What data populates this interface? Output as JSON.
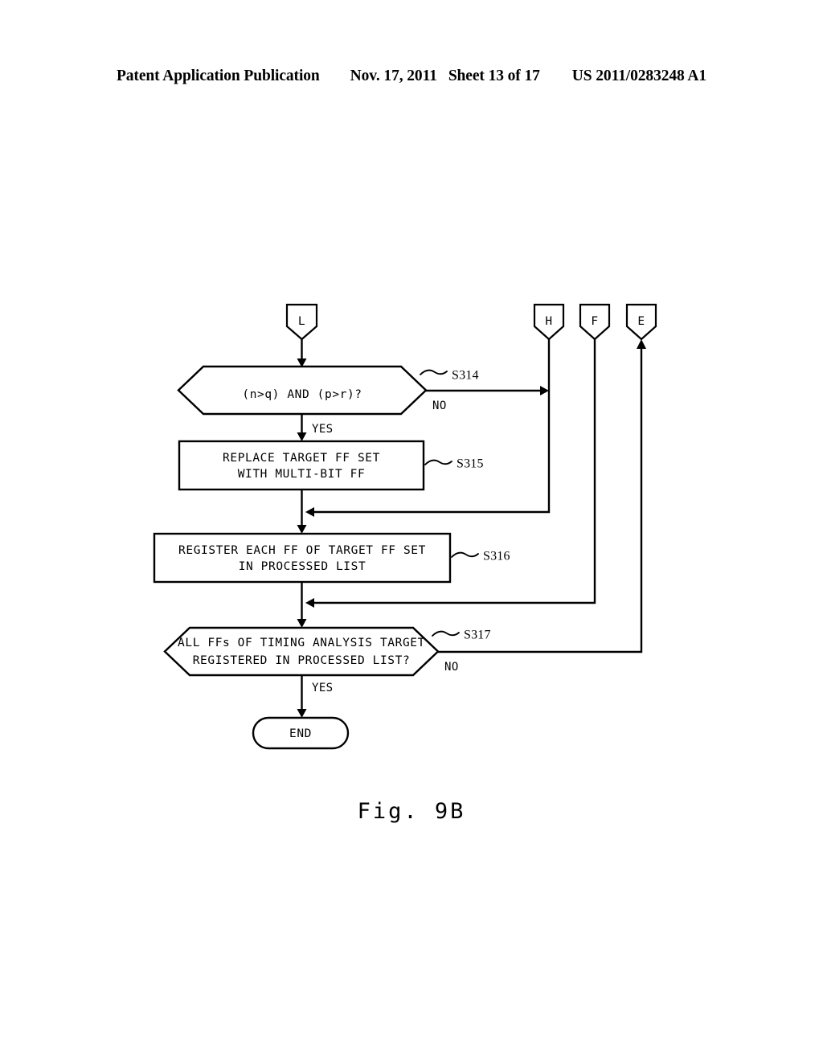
{
  "header": {
    "publication": "Patent Application Publication",
    "date": "Nov. 17, 2011",
    "sheet": "Sheet 13 of 17",
    "patent_number": "US 2011/0283248 A1"
  },
  "figure": {
    "caption": "Fig. 9B",
    "type": "flowchart"
  },
  "connectors": {
    "entry": {
      "id": "L",
      "label": "L"
    },
    "h": {
      "id": "H",
      "label": "H"
    },
    "f": {
      "id": "F",
      "label": "F"
    },
    "e": {
      "id": "E",
      "label": "E"
    }
  },
  "nodes": {
    "s314": {
      "step": "S314",
      "shape": "decision",
      "text_lines": [
        "(n>q) AND (p>r)?"
      ],
      "line1": "(n>q)  AND  (p>r)?"
    },
    "s315": {
      "step": "S315",
      "shape": "process",
      "text_lines": [
        "REPLACE TARGET FF SET",
        "WITH MULTI-BIT FF"
      ],
      "line1": "REPLACE TARGET FF SET",
      "line2": "WITH MULTI-BIT FF"
    },
    "s316": {
      "step": "S316",
      "shape": "process",
      "text_lines": [
        "REGISTER EACH FF OF TARGET FF SET",
        "IN PROCESSED LIST"
      ],
      "line1": "REGISTER EACH FF OF TARGET FF SET",
      "line2": "IN PROCESSED LIST"
    },
    "s317": {
      "step": "S317",
      "shape": "decision",
      "text_lines": [
        "ALL FFs OF TIMING ANALYSIS TARGET",
        "REGISTERED IN PROCESSED LIST?"
      ],
      "line1": "ALL FFs OF TIMING ANALYSIS TARGET",
      "line2": "REGISTERED IN PROCESSED LIST?"
    },
    "end": {
      "shape": "terminator",
      "label": "END"
    }
  },
  "edge_labels": {
    "s314_yes": "YES",
    "s314_no": "NO",
    "s317_yes": "YES",
    "s317_no": "NO"
  },
  "colors": {
    "ink": "#000000",
    "paper": "#ffffff"
  }
}
